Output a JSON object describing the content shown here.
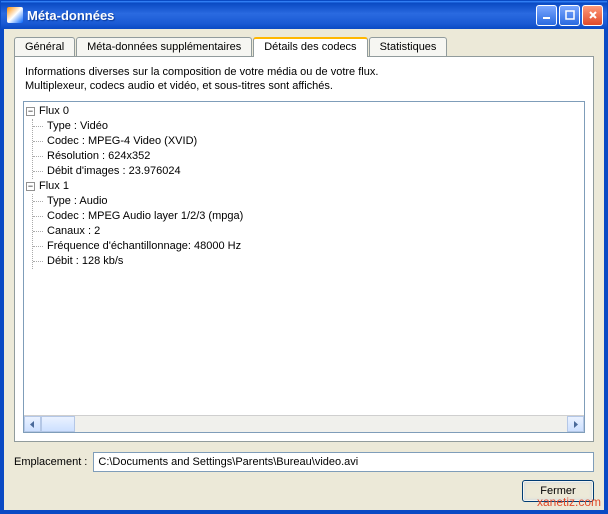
{
  "window": {
    "title": "Méta-données"
  },
  "tabs": {
    "items": [
      {
        "label": "Général"
      },
      {
        "label": "Méta-données supplémentaires"
      },
      {
        "label": "Détails des codecs"
      },
      {
        "label": "Statistiques"
      }
    ],
    "active_index": 2
  },
  "description": {
    "line1": "Informations diverses sur la composition de votre média ou de votre flux.",
    "line2": "Multiplexeur, codecs audio et vidéo, et sous-titres sont affichés."
  },
  "streams": [
    {
      "label": "Flux 0",
      "expanded": true,
      "properties": [
        "Type : Vidéo",
        "Codec : MPEG-4 Video (XVID)",
        "Résolution : 624x352",
        "Débit d'images : 23.976024"
      ]
    },
    {
      "label": "Flux 1",
      "expanded": true,
      "properties": [
        "Type : Audio",
        "Codec : MPEG Audio layer 1/2/3 (mpga)",
        "Canaux : 2",
        "Fréquence d'échantillonnage: 48000 Hz",
        "Débit : 128 kb/s"
      ]
    }
  ],
  "location": {
    "label": "Emplacement :",
    "value": "C:\\Documents and Settings\\Parents\\Bureau\\video.avi"
  },
  "buttons": {
    "close": "Fermer"
  },
  "watermark": "xanetiz.com"
}
